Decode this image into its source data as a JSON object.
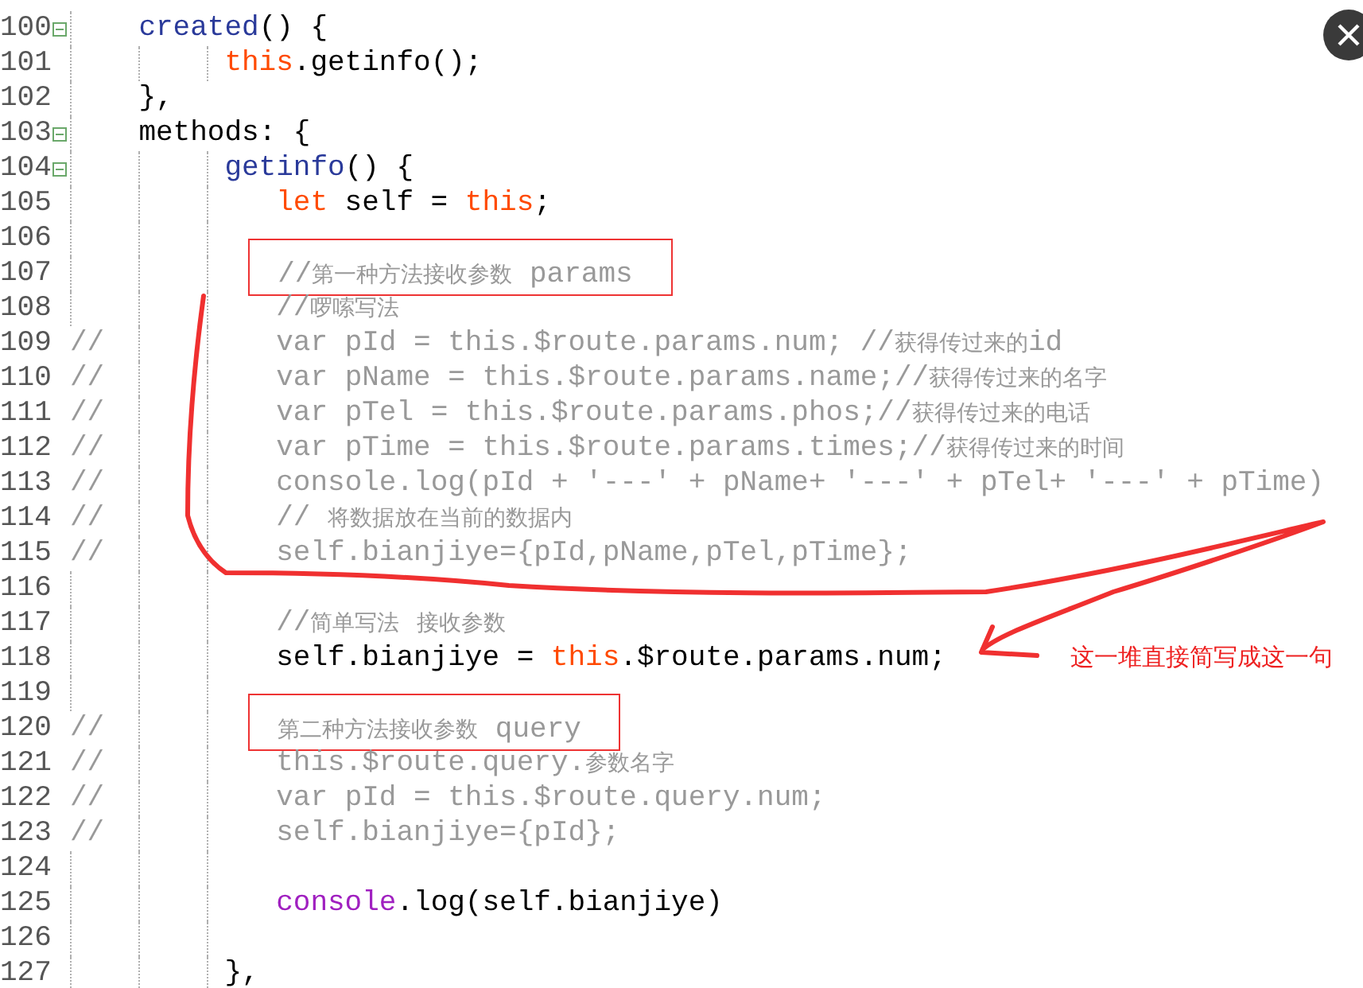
{
  "editor": {
    "lines": [
      {
        "number": "100",
        "fold": true,
        "tokens": [
          {
            "text": "created",
            "kind": "function"
          },
          {
            "text": "() {",
            "kind": "plain"
          }
        ],
        "children": [
          {
            "number": "101",
            "fold": false,
            "tokens": [
              {
                "text": "this",
                "kind": "keyword"
              },
              {
                "text": ".getinfo();",
                "kind": "plain"
              }
            ]
          }
        ]
      },
      {
        "number": "102",
        "fold": false,
        "tokens": [
          {
            "text": "},",
            "kind": "plain"
          }
        ]
      },
      {
        "number": "103",
        "fold": true,
        "tokens": [
          {
            "text": "methods: {",
            "kind": "plain"
          }
        ],
        "children": [
          {
            "number": "104",
            "fold": true,
            "tokens": [
              {
                "text": "getinfo",
                "kind": "function"
              },
              {
                "text": "() {",
                "kind": "plain"
              }
            ],
            "children": [
              {
                "number": "105",
                "fold": false,
                "tokens": [
                  {
                    "text": "let",
                    "kind": "keyword"
                  },
                  {
                    "text": " self = ",
                    "kind": "plain"
                  },
                  {
                    "text": "this",
                    "kind": "keyword"
                  },
                  {
                    "text": ";",
                    "kind": "plain"
                  }
                ]
              },
              {
                "number": "106",
                "fold": false
              },
              {
                "number": "107",
                "fold": false,
                "tokens": [
                  {
                    "text": "//第一种方法接收参数 params",
                    "kind": "comment",
                    "highlighted": true
                  }
                ]
              },
              {
                "number": "108",
                "fold": false,
                "tokens": [
                  {
                    "text": "//啰嗦写法",
                    "kind": "comment"
                  }
                ]
              },
              {
                "number": "109",
                "fold": false,
                "line_comment": "//",
                "tokens": [
                  {
                    "text": "var pId = this.$route.params.num; //获得传过来的id",
                    "kind": "comment"
                  }
                ]
              },
              {
                "number": "110",
                "fold": false,
                "line_comment": "//",
                "tokens": [
                  {
                    "text": "var pName = this.$route.params.name;//获得传过来的名字",
                    "kind": "comment"
                  }
                ]
              },
              {
                "number": "111",
                "fold": false,
                "line_comment": "//",
                "tokens": [
                  {
                    "text": "var pTel = this.$route.params.phos;//获得传过来的电话",
                    "kind": "comment"
                  }
                ]
              },
              {
                "number": "112",
                "fold": false,
                "line_comment": "//",
                "tokens": [
                  {
                    "text": "var pTime = this.$route.params.times;//获得传过来的时间",
                    "kind": "comment"
                  }
                ]
              },
              {
                "number": "113",
                "fold": false,
                "line_comment": "//",
                "tokens": [
                  {
                    "text": "console.log(pId + '---' + pName+ '---' + pTel+ '---' + pTime)",
                    "kind": "comment"
                  }
                ]
              },
              {
                "number": "114",
                "fold": false,
                "line_comment": "//",
                "tokens": [
                  {
                    "text": "// 将数据放在当前的数据内",
                    "kind": "comment"
                  }
                ]
              },
              {
                "number": "115",
                "fold": false,
                "line_comment": "//",
                "tokens": [
                  {
                    "text": "self.bianjiye={pId,pName,pTel,pTime};",
                    "kind": "comment"
                  }
                ]
              },
              {
                "number": "116",
                "fold": false
              },
              {
                "number": "117",
                "fold": false,
                "tokens": [
                  {
                    "text": "//简单写法 接收参数",
                    "kind": "comment"
                  }
                ]
              },
              {
                "number": "118",
                "fold": false,
                "tokens": [
                  {
                    "text": "self.bianjiye = ",
                    "kind": "plain"
                  },
                  {
                    "text": "this",
                    "kind": "keyword"
                  },
                  {
                    "text": ".$route.params.num;",
                    "kind": "plain"
                  }
                ]
              },
              {
                "number": "119",
                "fold": false
              },
              {
                "number": "120",
                "fold": false,
                "line_comment": "//",
                "tokens": [
                  {
                    "text": "第二种方法接收参数 query",
                    "kind": "comment",
                    "highlighted": true
                  }
                ]
              },
              {
                "number": "121",
                "fold": false,
                "line_comment": "//",
                "tokens": [
                  {
                    "text": "this.$route.query.参数名字",
                    "kind": "comment"
                  }
                ]
              },
              {
                "number": "122",
                "fold": false,
                "line_comment": "//",
                "tokens": [
                  {
                    "text": "var pId = this.$route.query.num;",
                    "kind": "comment"
                  }
                ]
              },
              {
                "number": "123",
                "fold": false,
                "line_comment": "//",
                "tokens": [
                  {
                    "text": "self.bianjiye={pId};",
                    "kind": "comment"
                  }
                ]
              },
              {
                "number": "124",
                "fold": false
              },
              {
                "number": "125",
                "fold": false,
                "tokens": [
                  {
                    "text": "console",
                    "kind": "console"
                  },
                  {
                    "text": ".log(self.bianjiye)",
                    "kind": "plain"
                  }
                ]
              },
              {
                "number": "126",
                "fold": false
              }
            ]
          },
          {
            "number": "127",
            "fold": false,
            "tokens": [
              {
                "text": "},",
                "kind": "plain"
              }
            ]
          }
        ]
      }
    ]
  },
  "annotation": {
    "note": "这一堆直接简写成这一句"
  }
}
